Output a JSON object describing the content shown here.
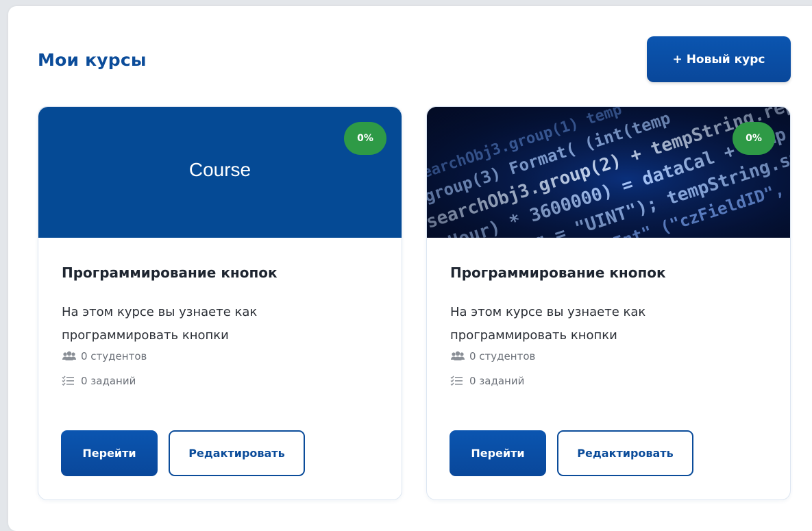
{
  "header": {
    "title": "Мои курсы",
    "new_course_label": "+ Новый курс"
  },
  "colors": {
    "brand_blue": "#0b4c9a",
    "progress_green": "#2e9a46",
    "cover_blue": "#054a95"
  },
  "courses": [
    {
      "cover_type": "solid",
      "cover_text": "Course",
      "progress": "0%",
      "title": "Программирование кнопок",
      "description": "На этом курсе вы узнаете как программировать кнопки",
      "students_icon": "users-icon",
      "students": "0 студентов",
      "tasks_icon": "task-list-icon",
      "tasks": "0 заданий",
      "go_label": "Перейти",
      "edit_label": "Редактировать"
    },
    {
      "cover_type": "image",
      "cover_image": "code-screen-image",
      "progress": "0%",
      "title": "Программирование кнопок",
      "description": "На этом курсе вы узнаете как программировать кнопки",
      "students_icon": "users-icon",
      "students": "0 студентов",
      "tasks_icon": "task-list-icon",
      "tasks": "0 заданий",
      "go_label": "Перейти",
      "edit_label": "Редактировать"
    }
  ]
}
